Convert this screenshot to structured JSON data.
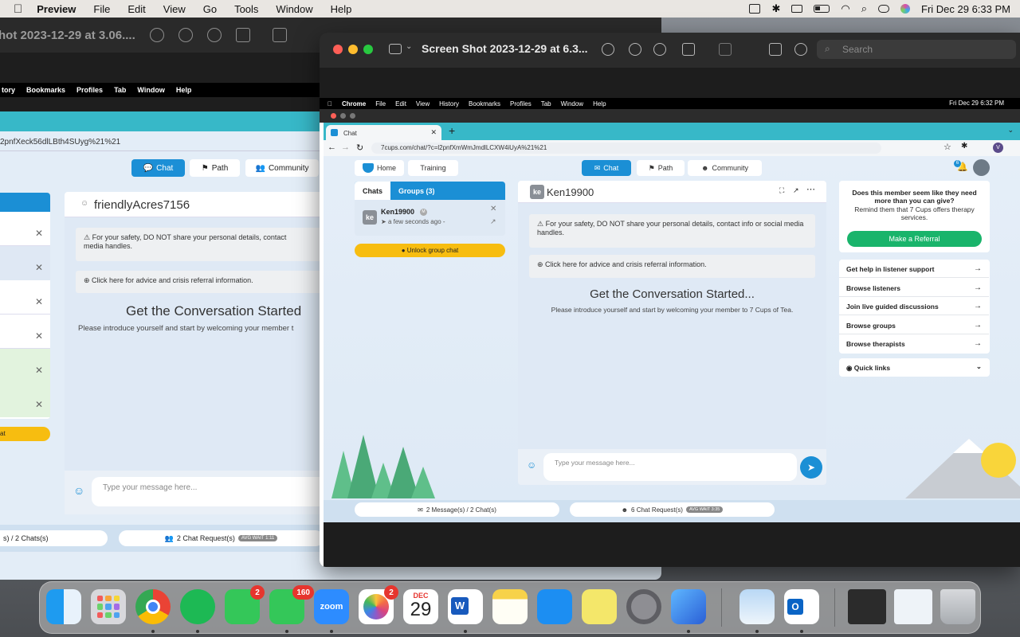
{
  "menubar": {
    "app": "Preview",
    "items": [
      "File",
      "Edit",
      "View",
      "Go",
      "Tools",
      "Window",
      "Help"
    ],
    "clock": "Fri Dec 29  6:33 PM"
  },
  "back_window": {
    "title": "hot 2023-12-29 at 3.06....",
    "chrome_menu": [
      "tory",
      "Bookmarks",
      "Profiles",
      "Tab",
      "Window",
      "Help"
    ],
    "url": "2pnfXeck56dlLBth4SUyg%21%21",
    "nav": {
      "chat": "Chat",
      "path": "Path",
      "community": "Community"
    },
    "username": "friendlyAcres7156",
    "safety": "For your safety, DO NOT share your personal details, contact",
    "safety_2": "media handles.",
    "advice": "Click here for advice and crisis referral information.",
    "heading": "Get the Conversation Started",
    "intro": "Please introduce yourself and start by welcoming your member t",
    "unlock_fragment": "at",
    "input_placeholder": "Type your message here...",
    "footer_messages": "s) / 2 Chats(s)",
    "footer_requests": "2 Chat Request(s)",
    "avg_wait": "AVG WAIT 1:11"
  },
  "front_window": {
    "title": "Screen Shot 2023-12-29 at 6.3...",
    "search_placeholder": "Search"
  },
  "inner": {
    "menu_app": "Chrome",
    "menu_items": [
      "File",
      "Edit",
      "View",
      "History",
      "Bookmarks",
      "Profiles",
      "Tab",
      "Window",
      "Help"
    ],
    "clock": "Fri Dec 29  6:32 PM",
    "tab_title": "Chat",
    "url": "7cups.com/chat/?c=l2pnfXmWmJmdlLCXW4iUyA%21%21",
    "nav": {
      "home": "Home",
      "training": "Training",
      "chat": "Chat",
      "path": "Path",
      "community": "Community"
    },
    "notif_count": "6",
    "tabs": {
      "chats": "Chats",
      "groups": "Groups (3)"
    },
    "chat_item": {
      "initials": "ke",
      "name": "Ken19900",
      "badge": "M",
      "time": "a few seconds ago -"
    },
    "unlock": "Unlock group chat",
    "chat_header": {
      "initials": "ke",
      "name": "Ken19900"
    },
    "safety": "For your safety, DO NOT share your personal details, contact info or social media handles.",
    "advice": "Click here for advice and crisis referral information.",
    "heading": "Get the Conversation Started...",
    "intro": "Please introduce yourself and start by welcoming your member to 7 Cups of Tea.",
    "input_placeholder": "Type your message here...",
    "referral": {
      "question": "Does this member seem like they need more than you can give?",
      "sub": "Remind them that 7 Cups offers therapy services.",
      "button": "Make a Referral"
    },
    "links": [
      "Get help in listener support",
      "Browse listeners",
      "Join live guided discussions",
      "Browse groups",
      "Browse therapists"
    ],
    "quick_links": "Quick links",
    "footer_messages": "2 Message(s) / 2 Chat(s)",
    "footer_requests": "6 Chat Request(s)",
    "avg_wait": "AVG WAIT 3:35"
  },
  "dock": {
    "facetime_badge": "2",
    "messages_badge": "160",
    "zoom_label": "zoom",
    "photos_badge": "2",
    "calendar_month": "DEC",
    "calendar_day": "29",
    "word_letter": "W",
    "outlook_letter": "O"
  },
  "colors": {
    "accent": "#1b8fd5",
    "teal": "#37b8c8",
    "green": "#19b46b",
    "yellow": "#f7bd10"
  }
}
